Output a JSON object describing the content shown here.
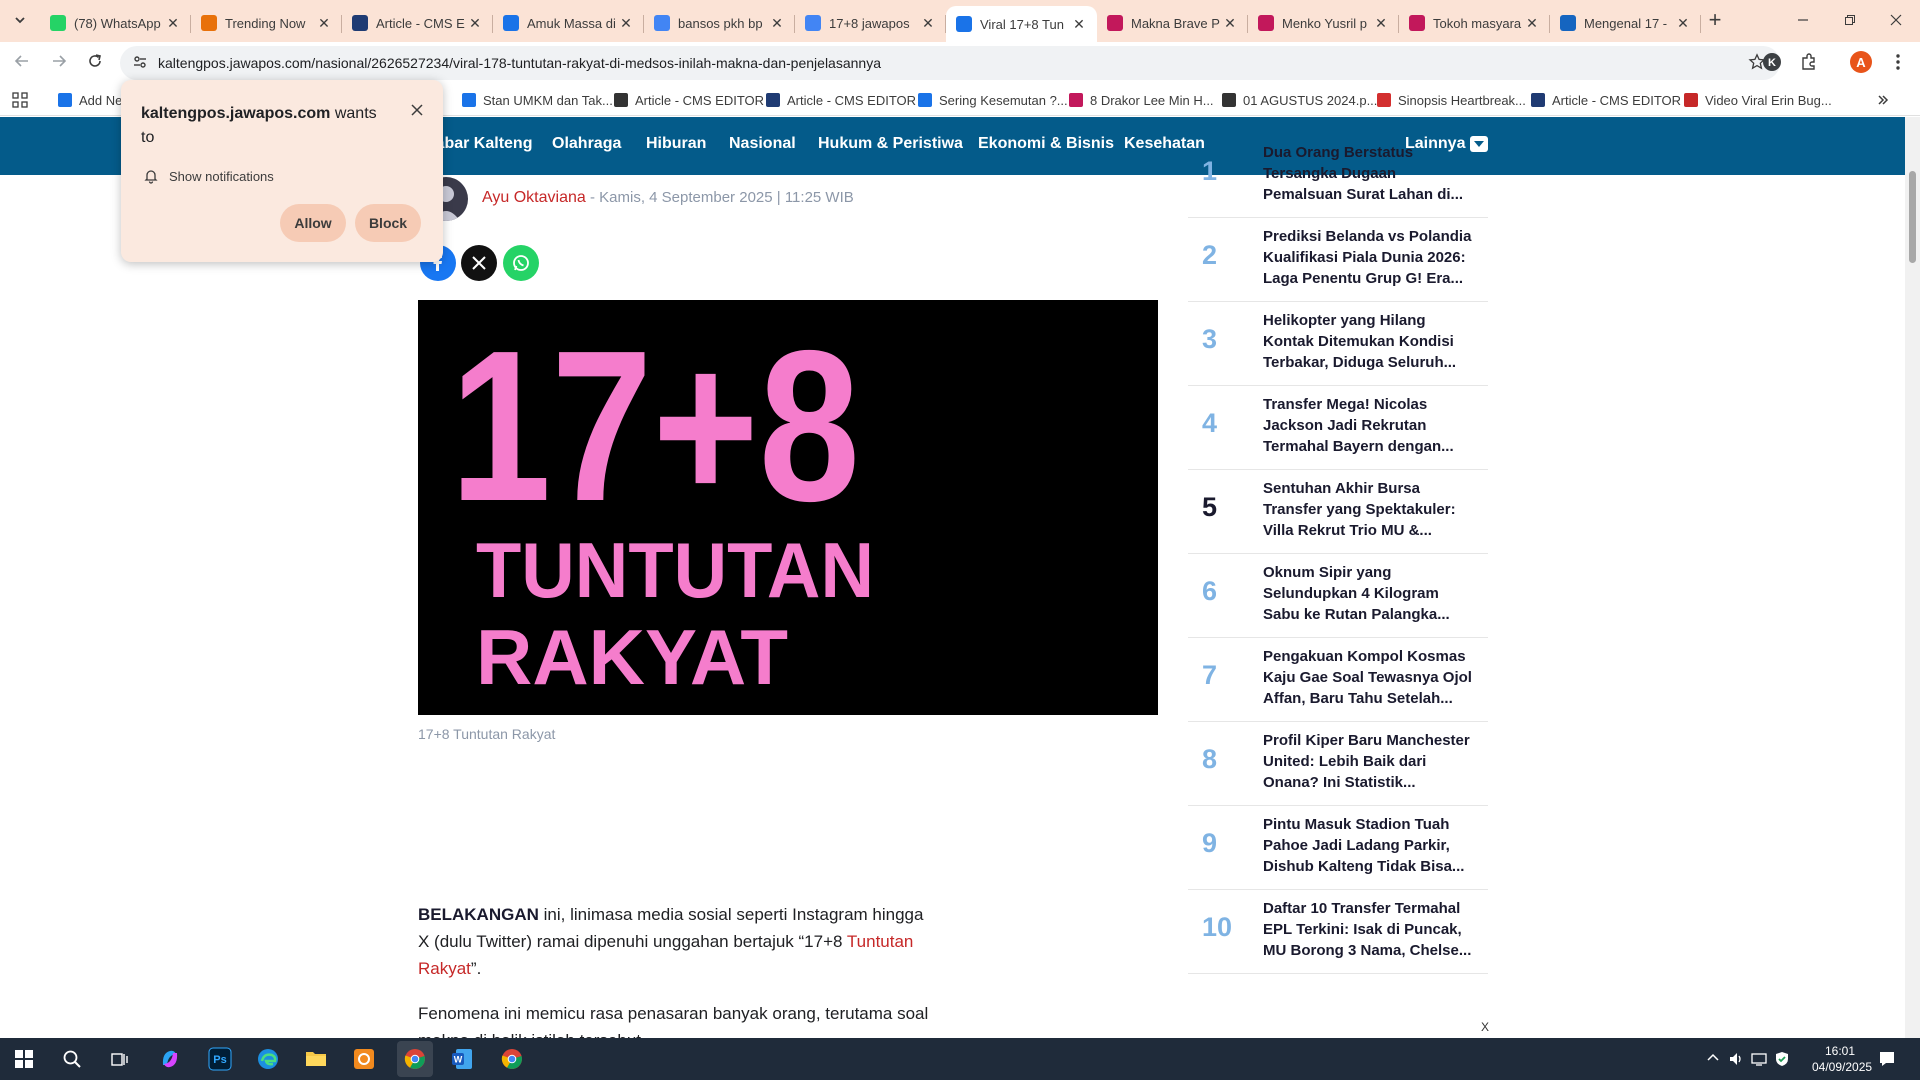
{
  "browser": {
    "tabs": [
      {
        "title": "(78) WhatsApp",
        "icon": "whatsapp-icon",
        "color": "#25d366"
      },
      {
        "title": "Trending Now",
        "icon": "trending-icon",
        "color": "#e8710a"
      },
      {
        "title": "Article - CMS E",
        "icon": "jp-icon",
        "color": "#1f3b73"
      },
      {
        "title": "Amuk Massa di",
        "icon": "bookmark-icon",
        "color": "#1a73e8"
      },
      {
        "title": "bansos pkh bp",
        "icon": "google-icon",
        "color": "#4285f4"
      },
      {
        "title": "17+8 jawapos",
        "icon": "google-icon",
        "color": "#4285f4"
      },
      {
        "title": "Viral 17+8 Tun",
        "icon": "globe-icon",
        "color": "#1a73e8",
        "active": true
      },
      {
        "title": "Makna Brave P",
        "icon": "brand-icon",
        "color": "#c2185b"
      },
      {
        "title": "Menko Yusril p",
        "icon": "brand-icon",
        "color": "#c2185b"
      },
      {
        "title": "Tokoh masyara",
        "icon": "brand-icon",
        "color": "#c2185b"
      },
      {
        "title": "Mengenal 17 -",
        "icon": "jp-icon",
        "color": "#1565c0"
      }
    ],
    "url": "kaltengpos.jawapos.com/nasional/2626527234/viral-178-tuntutan-rakyat-di-medsos-inilah-makna-dan-penjelasannya",
    "profile_initial": "A",
    "bookmarks": [
      {
        "label": "Add Ne",
        "color": "#1a73e8"
      },
      {
        "label": "Stan UMKM dan Tak...",
        "color": "#1a73e8"
      },
      {
        "label": "Article - CMS EDITOR",
        "color": "#333333"
      },
      {
        "label": "Article - CMS EDITOR",
        "color": "#1f3b73"
      },
      {
        "label": "Sering Kesemutan ?...",
        "color": "#1a73e8"
      },
      {
        "label": "8 Drakor Lee Min H...",
        "color": "#c2185b"
      },
      {
        "label": "01 AGUSTUS 2024.p...",
        "color": "#333333"
      },
      {
        "label": "Sinopsis Heartbreak...",
        "color": "#d32f2f"
      },
      {
        "label": "Article - CMS EDITOR",
        "color": "#1f3b73"
      },
      {
        "label": "Video Viral Erin Bug...",
        "color": "#c62828"
      }
    ]
  },
  "notification": {
    "site": "kaltengpos.jawapos.com",
    "suffix": " wants to",
    "permission": "Show notifications",
    "allow_label": "Allow",
    "block_label": "Block"
  },
  "site_nav": {
    "items": [
      "Kabar Kalteng",
      "Olahraga",
      "Hiburan",
      "Nasional",
      "Hukum & Peristiwa",
      "Ekonomi & Bisnis",
      "Kesehatan"
    ],
    "more_label": "Lainnya"
  },
  "article": {
    "author": "Ayu Oktaviana",
    "meta": "- Kamis, 4 September 2025 | 11:25 WIB",
    "hero_line1": "17+8",
    "hero_line2": "TUNTUTAN",
    "hero_line3": "RAKYAT",
    "caption": "17+8 Tuntutan Rakyat",
    "p1_lead": "BELAKANGAN",
    "p1_text": " ini, linimasa media sosial seperti Instagram hingga X (dulu Twitter) ramai dipenuhi unggahan bertajuk “17+8 ",
    "p1_link": "Tuntutan Rakyat",
    "p1_end": "”.",
    "p2_text": "Fenomena ini memicu rasa penasaran banyak orang, terutama soal makna di balik istilah tersebut."
  },
  "trending": [
    {
      "rank": "1",
      "title": "Dua Orang Berstatus Tersangka Dugaan Pemalsuan Surat Lahan di..."
    },
    {
      "rank": "2",
      "title": "Prediksi Belanda vs Polandia Kualifikasi Piala Dunia 2026: Laga Penentu Grup G! Era..."
    },
    {
      "rank": "3",
      "title": "Helikopter yang Hilang Kontak Ditemukan Kondisi Terbakar, Diduga Seluruh..."
    },
    {
      "rank": "4",
      "title": "Transfer Mega! Nicolas Jackson Jadi Rekrutan Termahal Bayern dengan..."
    },
    {
      "rank": "5",
      "title": "Sentuhan Akhir Bursa Transfer yang Spektakuler: Villa Rekrut Trio MU &..."
    },
    {
      "rank": "6",
      "title": "Oknum Sipir yang Selundupkan 4 Kilogram Sabu ke Rutan Palangka..."
    },
    {
      "rank": "7",
      "title": "Pengakuan Kompol Kosmas Kaju Gae Soal Tewasnya Ojol Affan, Baru Tahu Setelah..."
    },
    {
      "rank": "8",
      "title": "Profil Kiper Baru Manchester United: Lebih Baik dari Onana? Ini Statistik..."
    },
    {
      "rank": "9",
      "title": "Pintu Masuk Stadion Tuah Pahoe Jadi Ladang Parkir, Dishub Kalteng Tidak Bisa..."
    },
    {
      "rank": "10",
      "title": "Daftar 10 Transfer Termahal EPL Terkini: Isak di Puncak, MU Borong 3 Nama, Chelse..."
    }
  ],
  "ad_close_label": "X",
  "taskbar": {
    "time": "16:01",
    "date": "04/09/2025"
  }
}
